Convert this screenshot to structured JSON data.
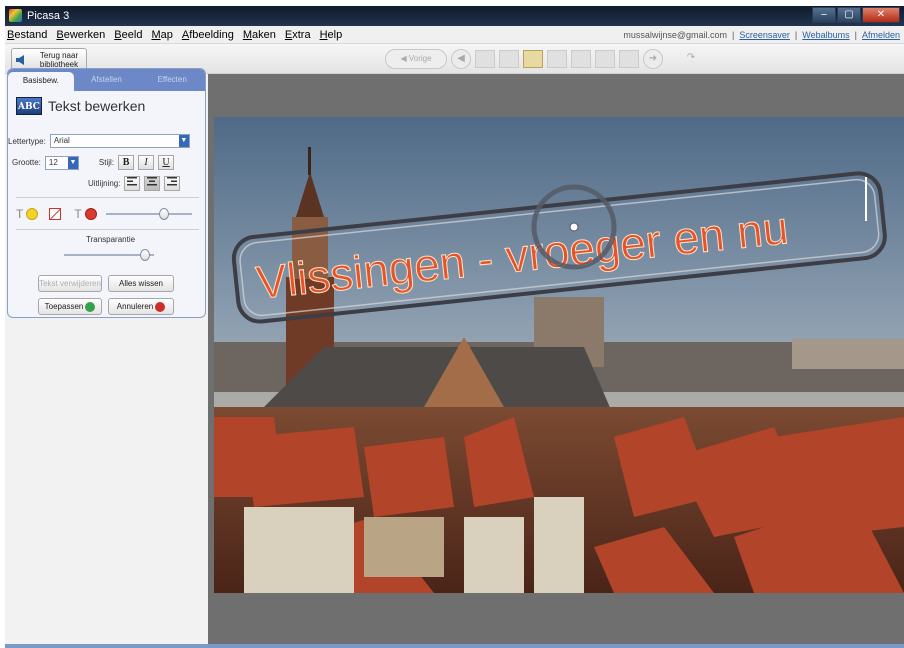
{
  "window": {
    "title": "Picasa 3",
    "controls": [
      "–",
      "▢",
      "✕"
    ]
  },
  "menu": {
    "items": [
      {
        "key": "B",
        "rest": "estand"
      },
      {
        "key": "B",
        "rest": "ewerken"
      },
      {
        "key": "B",
        "rest": "eeld"
      },
      {
        "key": "M",
        "rest": "ap"
      },
      {
        "key": "A",
        "rest": "fbeelding"
      },
      {
        "key": "M",
        "rest": "aken"
      },
      {
        "key": "E",
        "rest": "xtra"
      },
      {
        "key": "H",
        "rest": "elp"
      }
    ],
    "account": "mussalwijnse@gmail.com",
    "links": [
      "Screensaver",
      "Webalbums",
      "Afmelden"
    ],
    "separator": "|"
  },
  "toolbar": {
    "back_label": "Terug naar bibliotheek",
    "prev_label": "◀ Vorige",
    "next_arrow": "➜",
    "left_arrow": "◀",
    "rotate_icon": "↷"
  },
  "panel": {
    "tabs": [
      "Basisbew.",
      "Afstellen",
      "Effecten"
    ],
    "heading": "Tekst bewerken",
    "heading_icon": "ABC",
    "font_label": "Lettertype:",
    "font_value": "Arial",
    "size_label": "Grootte:",
    "size_value": "12",
    "style_label": "Stijl:",
    "style_buttons": [
      "B",
      "I",
      "U"
    ],
    "align_label": "Uitlijning:",
    "text_color_glyph": "T",
    "transparency_label": "Transparantie",
    "slider_text_color": 0.7,
    "slider_transparency": 0.95,
    "btn_clear_text": "Tekst verwijderen",
    "btn_clear_all": "Alles wissen",
    "btn_apply": "Toepassen",
    "btn_cancel": "Annuleren"
  },
  "overlay_text": "Vlissingen - vroeger en nu",
  "colors": {
    "accent_blue": "#6c88c6",
    "overlay_text": "#e4542a",
    "overlay_frame": "#3d3d45"
  }
}
